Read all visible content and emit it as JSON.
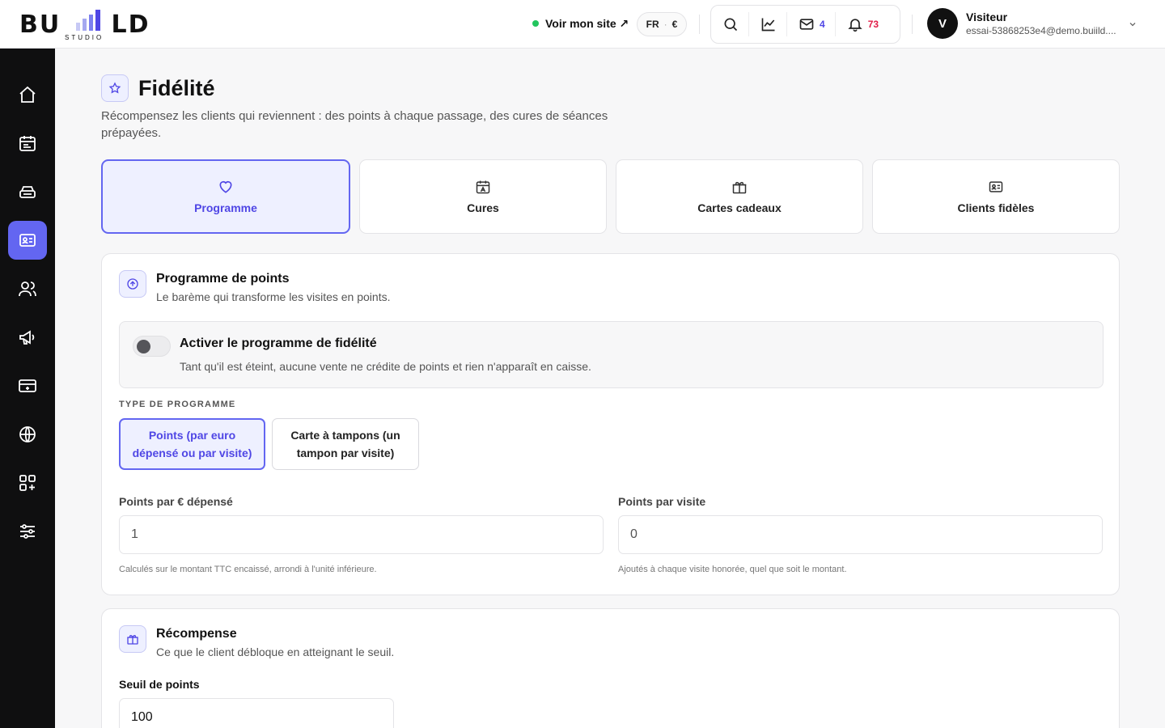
{
  "brand": {
    "wordmark": "BUILD",
    "tagline": "STUDIO"
  },
  "header": {
    "view_site": "Voir mon site ↗",
    "lang": "FR",
    "lang_sep": "·",
    "currency": "€",
    "messages_count": "4",
    "notifications_count": "73",
    "user": {
      "initial": "V",
      "name": "Visiteur",
      "email": "essai-53868253e4@demo.buiild...."
    }
  },
  "sidebar": {
    "items": [
      {
        "icon": "home-icon",
        "active": false
      },
      {
        "icon": "calendar-icon",
        "active": false
      },
      {
        "icon": "register-icon",
        "active": false
      },
      {
        "icon": "contact-card-icon",
        "active": true
      },
      {
        "icon": "users-icon",
        "active": false
      },
      {
        "icon": "megaphone-icon",
        "active": false
      },
      {
        "icon": "payment-terminal-icon",
        "active": false
      },
      {
        "icon": "globe-icon",
        "active": false
      },
      {
        "icon": "apps-icon",
        "active": false
      },
      {
        "icon": "sliders-icon",
        "active": false
      }
    ]
  },
  "page": {
    "title": "Fidélité",
    "subtitle": "Récompensez les clients qui reviennent : des points à chaque passage, des cures de séances prépayées."
  },
  "tabs": [
    {
      "label": "Programme",
      "icon": "heart-icon",
      "active": true
    },
    {
      "label": "Cures",
      "icon": "calendar-icon",
      "active": false
    },
    {
      "label": "Cartes cadeaux",
      "icon": "gift-icon",
      "active": false
    },
    {
      "label": "Clients fidèles",
      "icon": "contact-card-icon",
      "active": false
    }
  ],
  "points_card": {
    "title": "Programme de points",
    "subtitle": "Le barème qui transforme les visites en points.",
    "toggle": {
      "title": "Activer le programme de fidélité",
      "subtitle": "Tant qu'il est éteint, aucune vente ne crédite de points et rien n'apparaît en caisse.",
      "enabled": false
    },
    "type_label": "TYPE DE PROGRAMME",
    "type_options": [
      {
        "label": "Points (par euro dépensé ou par visite)",
        "selected": true
      },
      {
        "label": "Carte à tampons (un tampon par visite)",
        "selected": false
      }
    ],
    "per_euro": {
      "label": "Points par € dépensé",
      "value": "1",
      "help": "Calculés sur le montant TTC encaissé, arrondi à l'unité inférieure."
    },
    "per_visit": {
      "label": "Points par visite",
      "value": "0",
      "help": "Ajoutés à chaque visite honorée, quel que soit le montant."
    }
  },
  "reward_card": {
    "title": "Récompense",
    "subtitle": "Ce que le client débloque en atteignant le seuil.",
    "threshold": {
      "label": "Seuil de points",
      "value": "100"
    }
  },
  "colors": {
    "accent": "#6366f1",
    "accent_bg": "#eef0ff",
    "sidebar_bg": "#0f0f10",
    "online": "#22c55e",
    "alert": "#e11d48"
  }
}
